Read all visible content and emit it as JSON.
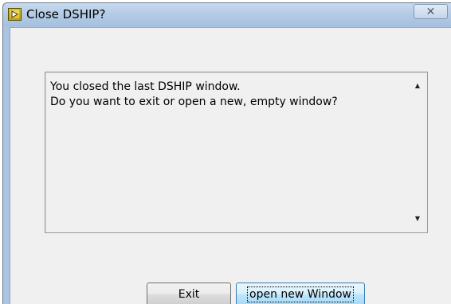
{
  "window": {
    "title": "Close DSHIP?",
    "close_glyph": "✕"
  },
  "icons": {
    "app": "labview-app-icon",
    "close": "close-icon",
    "scroll_up": "scroll-up-arrow-icon",
    "scroll_down": "scroll-down-arrow-icon"
  },
  "message": {
    "line1": "You closed the last DSHIP window.",
    "line2": "Do you want to exit or open a new, empty window?"
  },
  "buttons": {
    "exit_label": "Exit",
    "open_label": "open new Window"
  },
  "colors": {
    "titlebar": "#b4cce6",
    "dialog_bg": "#f0f0f0",
    "default_button_border": "#3c7fb1"
  }
}
